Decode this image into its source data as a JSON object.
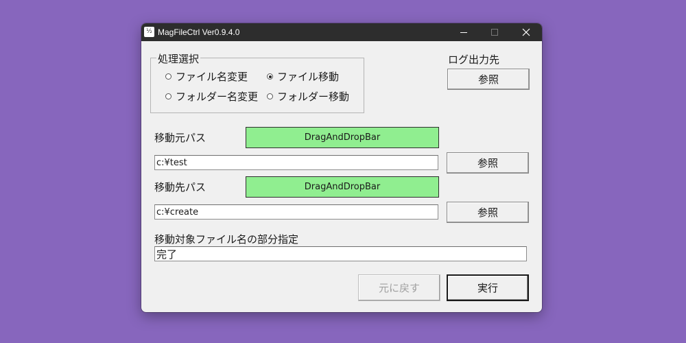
{
  "window": {
    "title": "MagFileCtrl Ver0.9.4.0",
    "icon_glyph": "½"
  },
  "processing": {
    "group_label": "処理選択",
    "options": [
      {
        "label": "ファイル名変更",
        "checked": false
      },
      {
        "label": "ファイル移動",
        "checked": true
      },
      {
        "label": "フォルダー名変更",
        "checked": false
      },
      {
        "label": "フォルダー移動",
        "checked": false
      }
    ]
  },
  "log": {
    "label": "ログ出力先",
    "browse_label": "参照"
  },
  "source": {
    "label": "移動元パス",
    "dnd_label": "DragAndDropBar",
    "path": "c:¥test",
    "browse_label": "参照"
  },
  "destination": {
    "label": "移動先パス",
    "dnd_label": "DragAndDropBar",
    "path": "c:¥create",
    "browse_label": "参照"
  },
  "partial_name": {
    "label": "移動対象ファイル名の部分指定",
    "value": "完了"
  },
  "actions": {
    "undo_label": "元に戻す",
    "undo_enabled": false,
    "execute_label": "実行"
  },
  "colors": {
    "background": "#8766bd",
    "titlebar": "#2d2d2d",
    "dnd_bar": "#90ee90"
  }
}
